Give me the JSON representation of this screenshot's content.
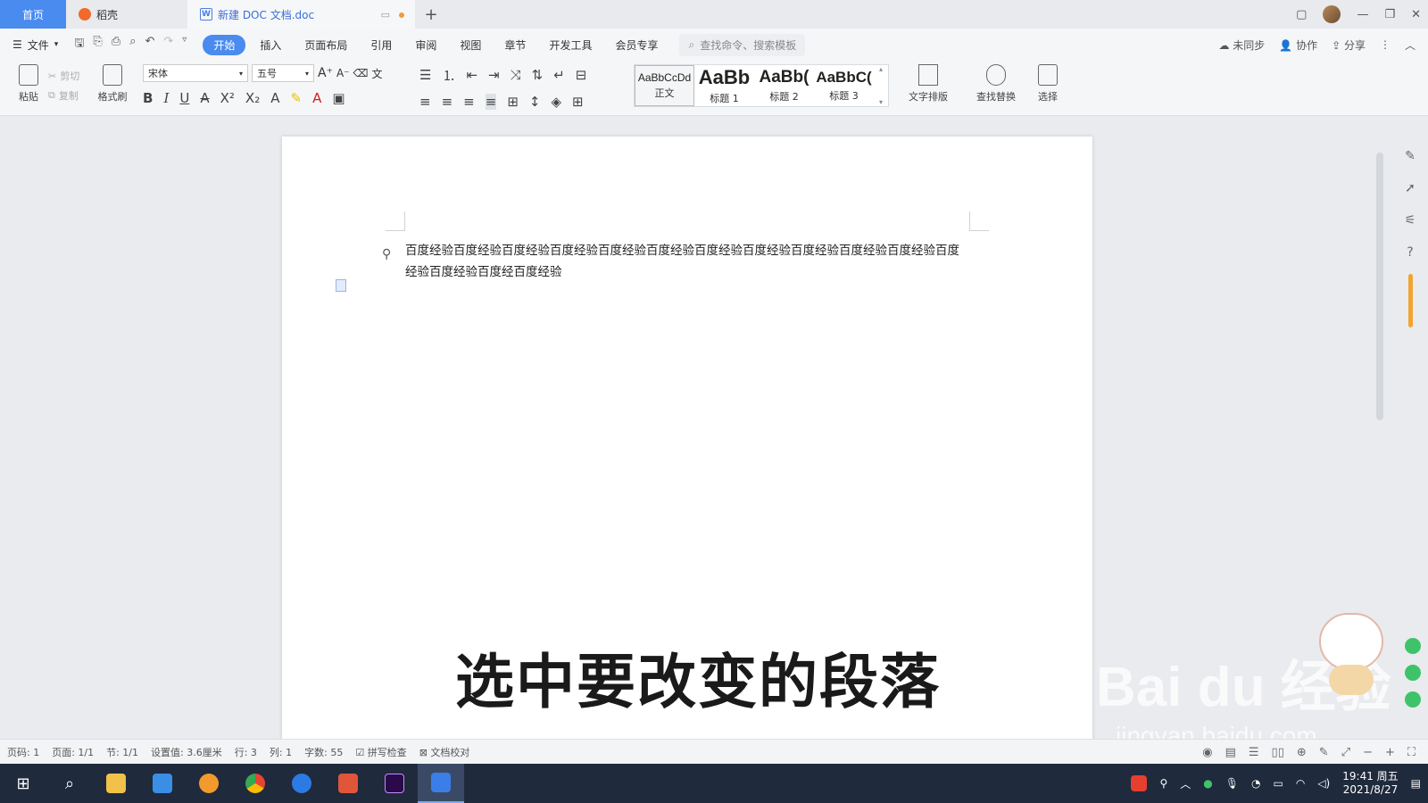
{
  "tabs": {
    "home": "首页",
    "daoke": "稻壳",
    "doc": "新建 DOC 文档.doc",
    "add": "+"
  },
  "menu": {
    "file": "文件",
    "items": [
      "开始",
      "插入",
      "页面布局",
      "引用",
      "审阅",
      "视图",
      "章节",
      "开发工具",
      "会员专享"
    ],
    "search_placeholder": "查找命令、搜索模板",
    "sync": "未同步",
    "collab": "协作",
    "share": "分享"
  },
  "toolbar": {
    "paste": "粘贴",
    "cut": "剪切",
    "copy": "复制",
    "format_painter": "格式刷",
    "font": "宋体",
    "size": "五号",
    "styles": [
      {
        "sample": "AaBbCcDd",
        "label": "正文"
      },
      {
        "sample": "AaBb",
        "label": "标题 1"
      },
      {
        "sample": "AaBb(",
        "label": "标题 2"
      },
      {
        "sample": "AaBbC(",
        "label": "标题 3"
      }
    ],
    "text_layout": "文字排版",
    "find_replace": "查找替换",
    "select": "选择"
  },
  "document": {
    "paragraph": "百度经验百度经验百度经验百度经验百度经验百度经验百度经验百度经验百度经验百度经验百度经验百度经验百度经验百度经百度经验"
  },
  "overlay": {
    "caption": "选中要改变的段落",
    "watermark": "Bai du 经验",
    "watermark_url": "jingyan.baidu.com"
  },
  "status": {
    "page_code": "页码: 1",
    "pages": "页面: 1/1",
    "section": "节: 1/1",
    "setting": "设置值: 3.6厘米",
    "row": "行: 3",
    "col": "列: 1",
    "words": "字数: 55",
    "spell": "拼写检查",
    "proof": "文档校对"
  },
  "taskbar": {
    "time": "19:41 周五",
    "date": "2021/8/27"
  }
}
